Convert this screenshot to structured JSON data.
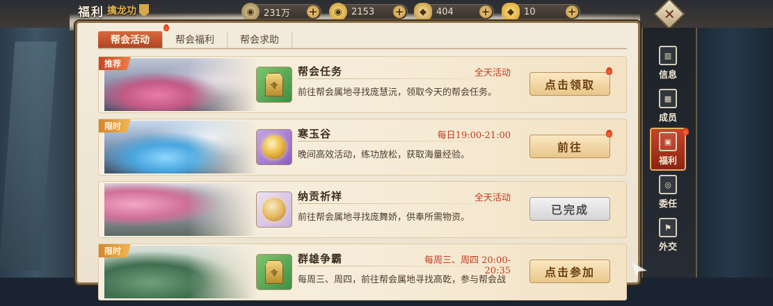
{
  "header": {
    "title": "福利",
    "subtitle": "擒龙功"
  },
  "resources": [
    {
      "name": "copper-coin",
      "icon": "coin-icon",
      "value": "231万"
    },
    {
      "name": "gold",
      "icon": "gold-coin-icon",
      "value": "2153"
    },
    {
      "name": "silver-ingot",
      "icon": "ingot-icon",
      "value": "404"
    },
    {
      "name": "gold-ingot",
      "icon": "gold-ingot-icon",
      "value": "10"
    }
  ],
  "tabs": [
    {
      "label": "帮会活动",
      "active": true
    },
    {
      "label": "帮会福利",
      "active": false
    },
    {
      "label": "帮会求助",
      "active": false
    }
  ],
  "activities": [
    {
      "tag": "推荐",
      "title": "帮会任务",
      "time": "全天活动",
      "desc": "前往帮会属地寻找庞慧沅，领取今天的帮会任务。",
      "button": "点击领取",
      "icon": "token-icon"
    },
    {
      "tag": "限时",
      "title": "寒玉谷",
      "time": "每日19:00-21:00",
      "desc": "晚间高效活动，练功放松，获取海量经验。",
      "button": "前往",
      "icon": "gold-coin-icon"
    },
    {
      "tag": "",
      "title": "纳贡祈祥",
      "time": "全天活动",
      "desc": "前往帮会属地寻找庞舞娇，供奉所需物资。",
      "button": "已完成",
      "icon": "coin-icon"
    },
    {
      "tag": "限时",
      "title": "群雄争霸",
      "time": "每周三、周四  20:00-20:35",
      "desc": "每周三、周四，前往帮会属地寻找高乾，参与帮会战",
      "button": "点击参加",
      "icon": "token-icon"
    }
  ],
  "side_nav": [
    {
      "label": "信息",
      "active": false
    },
    {
      "label": "成员",
      "active": false
    },
    {
      "label": "福利",
      "active": true
    },
    {
      "label": "委任",
      "active": false
    },
    {
      "label": "外交",
      "active": false
    }
  ],
  "colors": {
    "accent": "#c9452a",
    "time_text": "#c23a1c",
    "panel_bg": "#f3ebdc"
  }
}
